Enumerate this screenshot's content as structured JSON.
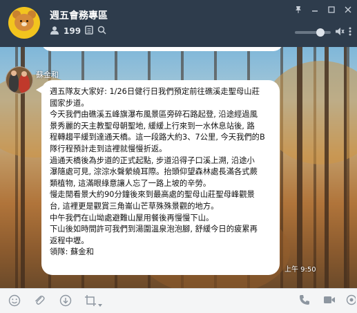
{
  "header": {
    "title": "週五會務專區",
    "member_count": "199",
    "icons": [
      "group-avatar-bear",
      "people-icon",
      "notes-icon",
      "search-icon",
      "volume-mute-icon",
      "more-icon"
    ],
    "window_controls": [
      "pin-icon",
      "minimize-icon",
      "maximize-icon",
      "close-icon"
    ],
    "volume_level": 0.78
  },
  "chat": {
    "sender_name": "蘇金和",
    "timestamp": "上午 9:50",
    "message_lines": [
      "週五隊友大家好: 1/26日健行日我們預定前往礁溪走聖母山莊",
      "國家步道。",
      "今天我們由礁溪五峰旗瀑布風景區旁碎石路起登, 沿途經過風",
      "景秀麗的天主教聖母朝聖地, 緩緩上行來到一水休息站後, 路",
      "程轉趨平緩到達通天橋。這一段路大約3、7公里, 今天我們的B",
      "隊行程預計走到這裡就慢慢折返。",
      "過通天橋後為步道的正式起點, 步道沿得子口溪上溯, 沿途小",
      "瀑隨處可見, 淙淙水聲縈繞耳際。抬頭仰望森林處長滿各式蕨",
      "類植物, 這滿眼綠意讓人忘了一路上坡的辛勞。",
      "慢走閒看景大約90分鐘後來到最高處的聖母山莊聖母峰觀景",
      "台, 這裡更是觀賞三角崙山芒草殊殊景觀的地方。",
      "中午我們在山坳處避難山屋用餐後再慢慢下山。",
      "下山後如時間許可我們到湯圍溫泉泡泡腳, 舒緩今日的疲累再",
      "返程中壢。",
      "領隊: 蘇金和"
    ]
  },
  "toolbar": {
    "icons": [
      "emoji-icon",
      "attach-icon",
      "download-icon",
      "crop-icon",
      "crop-dropdown-icon",
      "call-icon",
      "video-icon",
      "more-options-icon"
    ]
  },
  "colors": {
    "header_bg": "#2e3c4c",
    "bubble_bg": "#ffffff",
    "toolbar_bg": "#f4f5f6",
    "bear_yellow": "#f2c41e"
  }
}
